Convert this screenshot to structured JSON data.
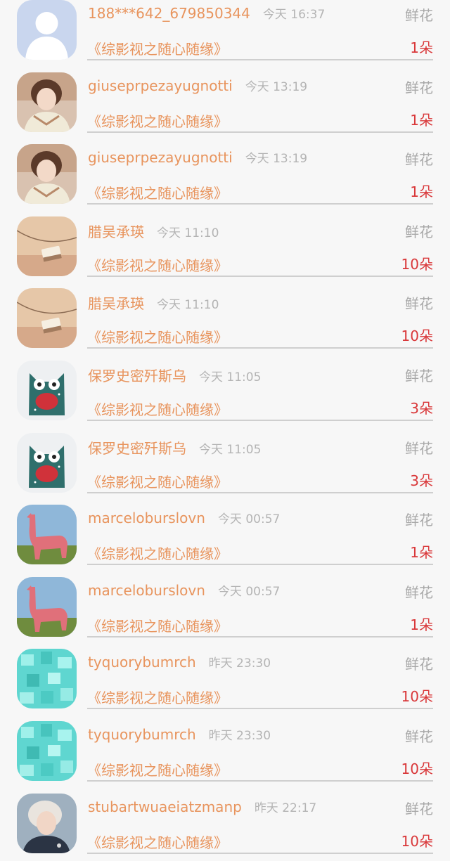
{
  "colors": {
    "name": "#e8945d",
    "time": "#b4b4b4",
    "gift_label": "#a8a8a8",
    "count": "#d9383a",
    "separator": "#cfcfcf",
    "background": "#f7f7f7"
  },
  "records": [
    {
      "user": "188***642_679850344",
      "time": "今天 16:37",
      "gift": "鲜花",
      "title": "《综影视之随心随缘》",
      "count": "1朵",
      "avatar": "default-avatar-icon"
    },
    {
      "user": "giuseprpezayugnotti",
      "time": "今天 13:19",
      "gift": "鲜花",
      "title": "《综影视之随心随缘》",
      "count": "1朵",
      "avatar": "girl-portrait-avatar"
    },
    {
      "user": "giuseprpezayugnotti",
      "time": "今天 13:19",
      "gift": "鲜花",
      "title": "《综影视之随心随缘》",
      "count": "1朵",
      "avatar": "girl-portrait-avatar"
    },
    {
      "user": "腊吴承瑛",
      "time": "今天 11:10",
      "gift": "鲜花",
      "title": "《综影视之随心随缘》",
      "count": "10朵",
      "avatar": "necklace-photo-avatar"
    },
    {
      "user": "腊吴承瑛",
      "time": "今天 11:10",
      "gift": "鲜花",
      "title": "《综影视之随心随缘》",
      "count": "10朵",
      "avatar": "necklace-photo-avatar"
    },
    {
      "user": "保罗史密歼斯乌",
      "time": "今天 11:05",
      "gift": "鲜花",
      "title": "《综影视之随心随缘》",
      "count": "3朵",
      "avatar": "owl-toy-avatar"
    },
    {
      "user": "保罗史密歼斯乌",
      "time": "今天 11:05",
      "gift": "鲜花",
      "title": "《综影视之随心随缘》",
      "count": "3朵",
      "avatar": "owl-toy-avatar"
    },
    {
      "user": "marceloburslovn",
      "time": "今天 00:57",
      "gift": "鲜花",
      "title": "《综影视之随心随缘》",
      "count": "1朵",
      "avatar": "pink-llama-avatar"
    },
    {
      "user": "marceloburslovn",
      "time": "今天 00:57",
      "gift": "鲜花",
      "title": "《综影视之随心随缘》",
      "count": "1朵",
      "avatar": "pink-llama-avatar"
    },
    {
      "user": "tyquorybumrch",
      "time": "昨天 23:30",
      "gift": "鲜花",
      "title": "《综影视之随心随缘》",
      "count": "10朵",
      "avatar": "aqua-cubes-avatar"
    },
    {
      "user": "tyquorybumrch",
      "time": "昨天 23:30",
      "gift": "鲜花",
      "title": "《综影视之随心随缘》",
      "count": "10朵",
      "avatar": "aqua-cubes-avatar"
    },
    {
      "user": "stubartwuaeiatzmanp",
      "time": "昨天 22:17",
      "gift": "鲜花",
      "title": "《综影视之随心随缘》",
      "count": "10朵",
      "avatar": "boy-portrait-avatar"
    }
  ]
}
